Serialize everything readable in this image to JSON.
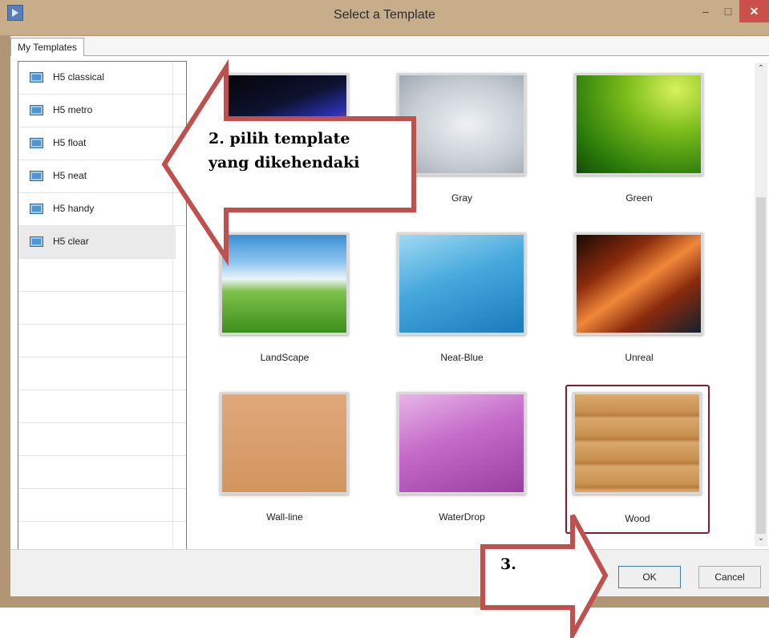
{
  "window": {
    "title": "Select a Template"
  },
  "tabs": [
    {
      "label": "My Templates"
    }
  ],
  "sidebar": {
    "items": [
      {
        "label": "H5 classical",
        "selected": false
      },
      {
        "label": "H5 metro",
        "selected": false
      },
      {
        "label": "H5 float",
        "selected": false
      },
      {
        "label": "H5 neat",
        "selected": false
      },
      {
        "label": "H5 handy",
        "selected": false
      },
      {
        "label": "H5 clear",
        "selected": true
      }
    ]
  },
  "templates": [
    {
      "label": "",
      "selected": false
    },
    {
      "label": "Gray",
      "selected": false
    },
    {
      "label": "Green",
      "selected": false
    },
    {
      "label": "LandScape",
      "selected": false
    },
    {
      "label": "Neat-Blue",
      "selected": false
    },
    {
      "label": "Unreal",
      "selected": false
    },
    {
      "label": "Wall-line",
      "selected": false
    },
    {
      "label": "WaterDrop",
      "selected": false
    },
    {
      "label": "Wood",
      "selected": true
    }
  ],
  "buttons": {
    "ok": "OK",
    "cancel": "Cancel"
  },
  "annotations": {
    "step2_line1": "2. pilih template",
    "step2_line2": "yang dikehendaki",
    "step3": "3."
  },
  "colors": {
    "annotation_arrow_border": "#c0504d",
    "selection_border": "#7d1f2c",
    "close_button": "#c9504b"
  }
}
